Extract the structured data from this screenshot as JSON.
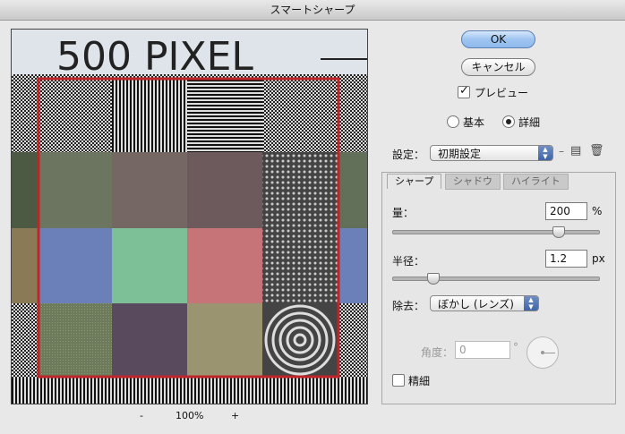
{
  "window": {
    "title": "スマートシャープ"
  },
  "preview": {
    "label_text": "500 PIXEL"
  },
  "zoom": {
    "minus": "-",
    "value": "100%",
    "plus": "+"
  },
  "buttons": {
    "ok": "OK",
    "cancel": "キャンセル"
  },
  "preview_toggle": {
    "label": "プレビュー",
    "checked": true
  },
  "mode": {
    "basic": "基本",
    "advanced": "詳細",
    "selected": "advanced"
  },
  "settings": {
    "label": "設定：",
    "value": "初期設定"
  },
  "tabs": [
    {
      "label": "シャープ",
      "active": true
    },
    {
      "label": "シャドウ",
      "active": false
    },
    {
      "label": "ハイライト",
      "active": false
    }
  ],
  "amount": {
    "label": "量：",
    "value": "200",
    "unit": "%",
    "slider_fraction": 0.81
  },
  "radius": {
    "label": "半径：",
    "value": "1.2",
    "unit": "px",
    "slider_fraction": 0.2
  },
  "remove": {
    "label": "除去：",
    "value": "ぼかし (レンズ)"
  },
  "angle": {
    "label": "角度：",
    "value": "0",
    "unit": "°"
  },
  "fine": {
    "label": "精細",
    "checked": false
  },
  "colors": {
    "red_frame": "#c0252a",
    "ok_blue": "#9ec4f0"
  }
}
